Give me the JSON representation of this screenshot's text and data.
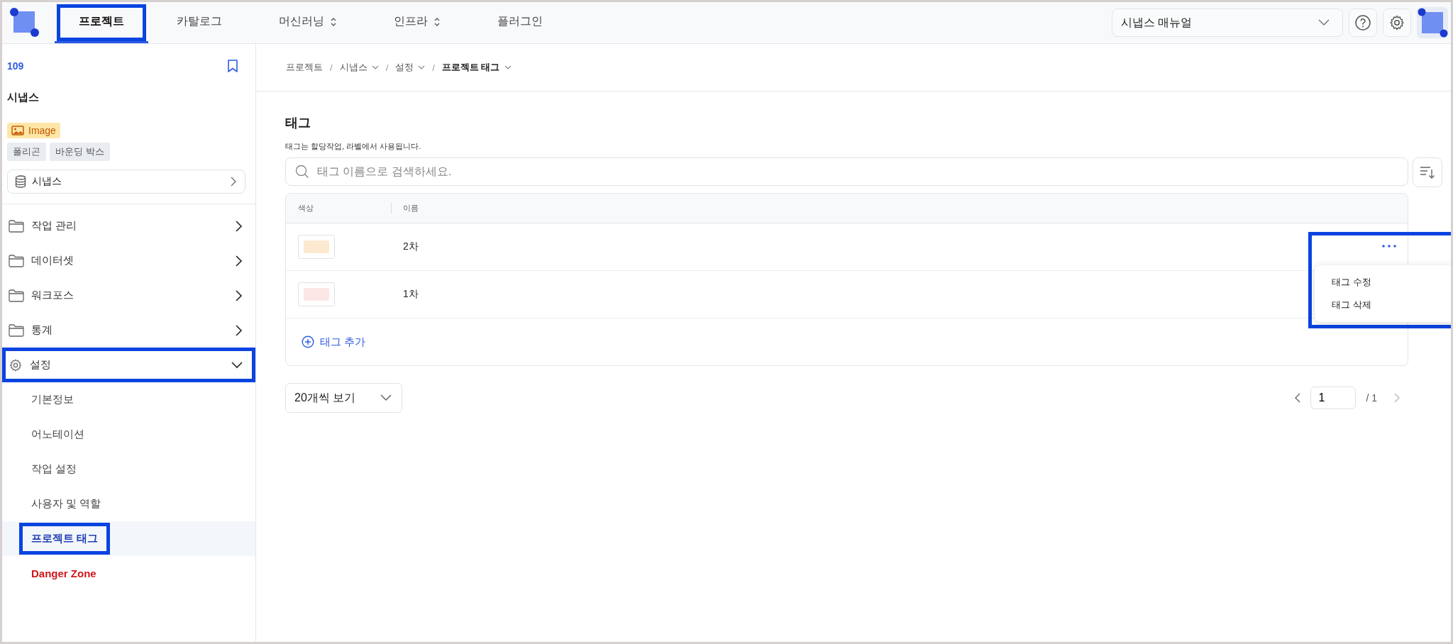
{
  "top_nav": {
    "tabs": [
      {
        "label": "프로젝트",
        "kind": "plain",
        "selected": true,
        "highlighted": true
      },
      {
        "label": "카탈로그",
        "kind": "plain",
        "selected": false,
        "highlighted": false
      },
      {
        "label": "머신러닝",
        "kind": "dropdown",
        "selected": false,
        "highlighted": false
      },
      {
        "label": "인프라",
        "kind": "dropdown",
        "selected": false,
        "highlighted": false
      },
      {
        "label": "플러그인",
        "kind": "plain",
        "selected": false,
        "highlighted": false
      }
    ]
  },
  "manual_select": {
    "value": "시냅스 매뉴얼"
  },
  "project": {
    "id": "109",
    "title": "시냅스",
    "data_type": "Image",
    "annotation_types": [
      "폴리곤",
      "바운딩 박스"
    ],
    "dataset": "시냅스"
  },
  "sidebar": {
    "items": [
      {
        "label": "작업 관리",
        "kind": "group",
        "expanded": false,
        "highlighted": false
      },
      {
        "label": "데이터셋",
        "kind": "group",
        "expanded": false,
        "highlighted": false
      },
      {
        "label": "워크포스",
        "kind": "group",
        "expanded": false,
        "highlighted": false
      },
      {
        "label": "통계",
        "kind": "group",
        "expanded": false,
        "highlighted": false
      },
      {
        "label": "설정",
        "kind": "settings",
        "expanded": true,
        "highlighted": true,
        "children": [
          {
            "label": "기본정보",
            "kind": "normal",
            "selected": false,
            "highlighted": false
          },
          {
            "label": "어노테이션",
            "kind": "normal",
            "selected": false,
            "highlighted": false
          },
          {
            "label": "작업 설정",
            "kind": "normal",
            "selected": false,
            "highlighted": false
          },
          {
            "label": "사용자 및 역할",
            "kind": "normal",
            "selected": false,
            "highlighted": false
          },
          {
            "label": "프로젝트 태그",
            "kind": "normal",
            "selected": true,
            "highlighted": true
          },
          {
            "label": "Danger Zone",
            "kind": "danger",
            "selected": false,
            "highlighted": false
          }
        ]
      }
    ]
  },
  "breadcrumb": {
    "separator": "/",
    "items": [
      {
        "label": "프로젝트",
        "dropdown": false,
        "current": false
      },
      {
        "label": "시냅스",
        "dropdown": true,
        "current": false
      },
      {
        "label": "설정",
        "dropdown": true,
        "current": false
      },
      {
        "label": "프로젝트 태그",
        "dropdown": true,
        "current": true
      }
    ]
  },
  "section": {
    "title": "태그",
    "description": "태그는 할당작업, 라벨에서 사용됩니다."
  },
  "search": {
    "placeholder": "태그 이름으로 검색하세요."
  },
  "table": {
    "columns": [
      "색상",
      "이름"
    ],
    "rows": [
      {
        "color": "#fde9cf",
        "name": "2차",
        "actions_visible": true,
        "menu_open": true
      },
      {
        "color": "#fde6e6",
        "name": "1차",
        "actions_visible": false,
        "menu_open": false
      }
    ],
    "row_menu": {
      "highlighted": true,
      "items": [
        "태그 수정",
        "태그 삭제"
      ]
    },
    "add_label": "태그 추가"
  },
  "page_size": {
    "value": "20개씩 보기"
  },
  "pagination": {
    "page": "1",
    "total": "/ 1"
  }
}
